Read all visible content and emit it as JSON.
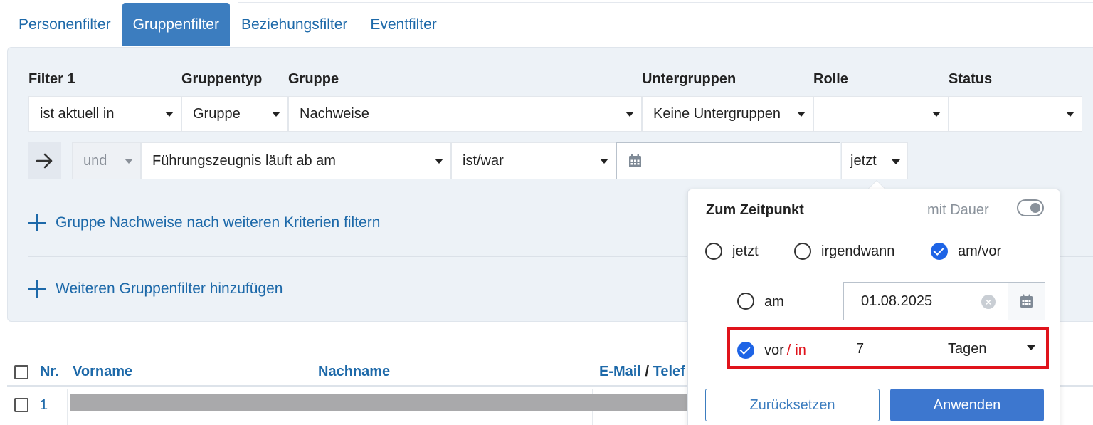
{
  "tabs": [
    {
      "label": "Personenfilter",
      "active": false
    },
    {
      "label": "Gruppenfilter",
      "active": true
    },
    {
      "label": "Beziehungsfilter",
      "active": false
    },
    {
      "label": "Eventfilter",
      "active": false
    }
  ],
  "filter": {
    "headers": {
      "filter": "Filter 1",
      "gruppentyp": "Gruppentyp",
      "gruppe": "Gruppe",
      "untergruppen": "Untergruppen",
      "rolle": "Rolle",
      "status": "Status"
    },
    "row1": {
      "condition": "ist aktuell in",
      "gruppentyp": "Gruppe",
      "gruppe": "Nachweise",
      "untergruppen": "Keine Untergruppen",
      "rolle": "",
      "status": ""
    },
    "row2": {
      "connector": "und",
      "criterion": "Führungszeugnis läuft ab am",
      "operator": "ist/war",
      "date_value": "",
      "time_mode": "jetzt"
    },
    "add_criteria_link": "Gruppe Nachweise nach weiteren Kriterien filtern",
    "add_group_filter_link": "Weiteren Gruppenfilter hinzufügen"
  },
  "popover": {
    "title": "Zum Zeitpunkt",
    "duration_label": "mit Dauer",
    "duration_on": false,
    "options": [
      {
        "label": "jetzt",
        "selected": false
      },
      {
        "label": "irgendwann",
        "selected": false
      },
      {
        "label": "am/vor",
        "selected": true
      }
    ],
    "am_label": "am",
    "am_selected": false,
    "am_date": "01.08.2025",
    "vor_label": "vor",
    "slash": "/",
    "in_label": "in",
    "vor_selected": true,
    "amount": "7",
    "unit": "Tagen",
    "reset_button": "Zurücksetzen",
    "apply_button": "Anwenden"
  },
  "table": {
    "columns": {
      "nr": "Nr.",
      "vorname": "Vorname",
      "nachname": "Nachname",
      "email": "E-Mail",
      "slash": "/",
      "telefon": "Telef"
    },
    "rows": [
      {
        "nr": "1"
      }
    ]
  },
  "colors": {
    "link": "#1d69a9",
    "active_tab": "#3c7dbf",
    "checkbox_blue": "#1e64e6",
    "highlight_red": "#e0131b",
    "apply_button": "#3d77cf"
  }
}
